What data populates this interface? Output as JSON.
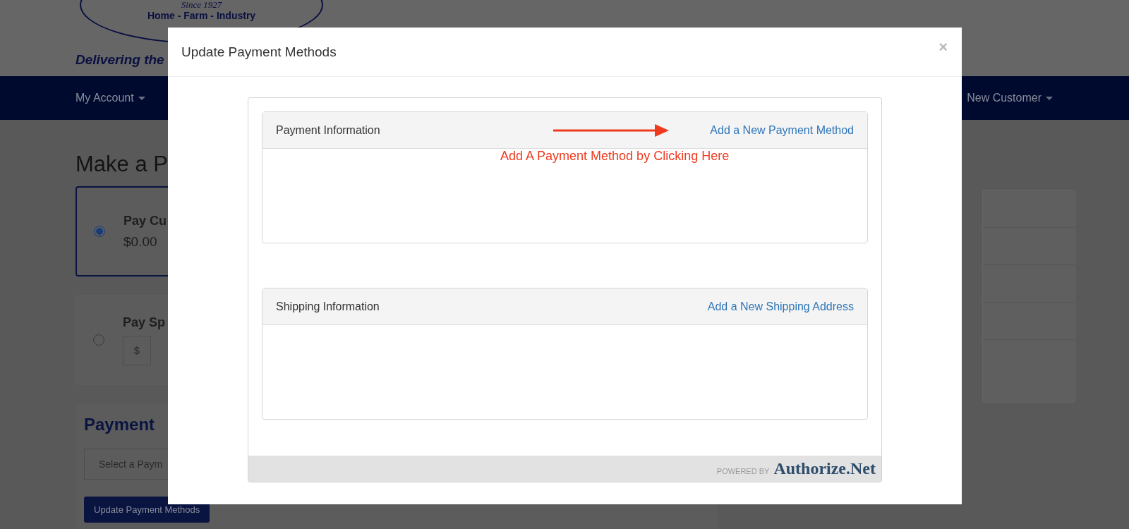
{
  "header": {
    "logo": {
      "since": "Since 1927",
      "tagline": "Home - Farm - Industry"
    },
    "slogan": "Delivering the"
  },
  "nav": {
    "items": [
      {
        "label": "My Account",
        "dropdown": true
      },
      {
        "label": "New Customer",
        "dropdown": true
      }
    ]
  },
  "page": {
    "title": "Make a P",
    "options": [
      {
        "kind": "amount",
        "title": "Pay Cu",
        "amount": "$0.00",
        "selected": true
      },
      {
        "kind": "input",
        "title": "Pay Sp",
        "prefix": "$",
        "selected": false
      }
    ],
    "payment": {
      "title": "Payment",
      "select": {
        "placeholder": "Select a Paym"
      },
      "button": "Update Payment Methods"
    }
  },
  "modal": {
    "title": "Update Payment Methods",
    "close": "×",
    "panels": [
      {
        "title": "Payment Information",
        "link": "Add a New Payment Method"
      },
      {
        "title": "Shipping Information",
        "link": "Add a New Shipping Address"
      }
    ],
    "annotation": {
      "text": "Add A Payment Method by Clicking Here"
    },
    "footer": {
      "powered_by": "POWERED BY",
      "brand": "Authorize.Net"
    }
  }
}
